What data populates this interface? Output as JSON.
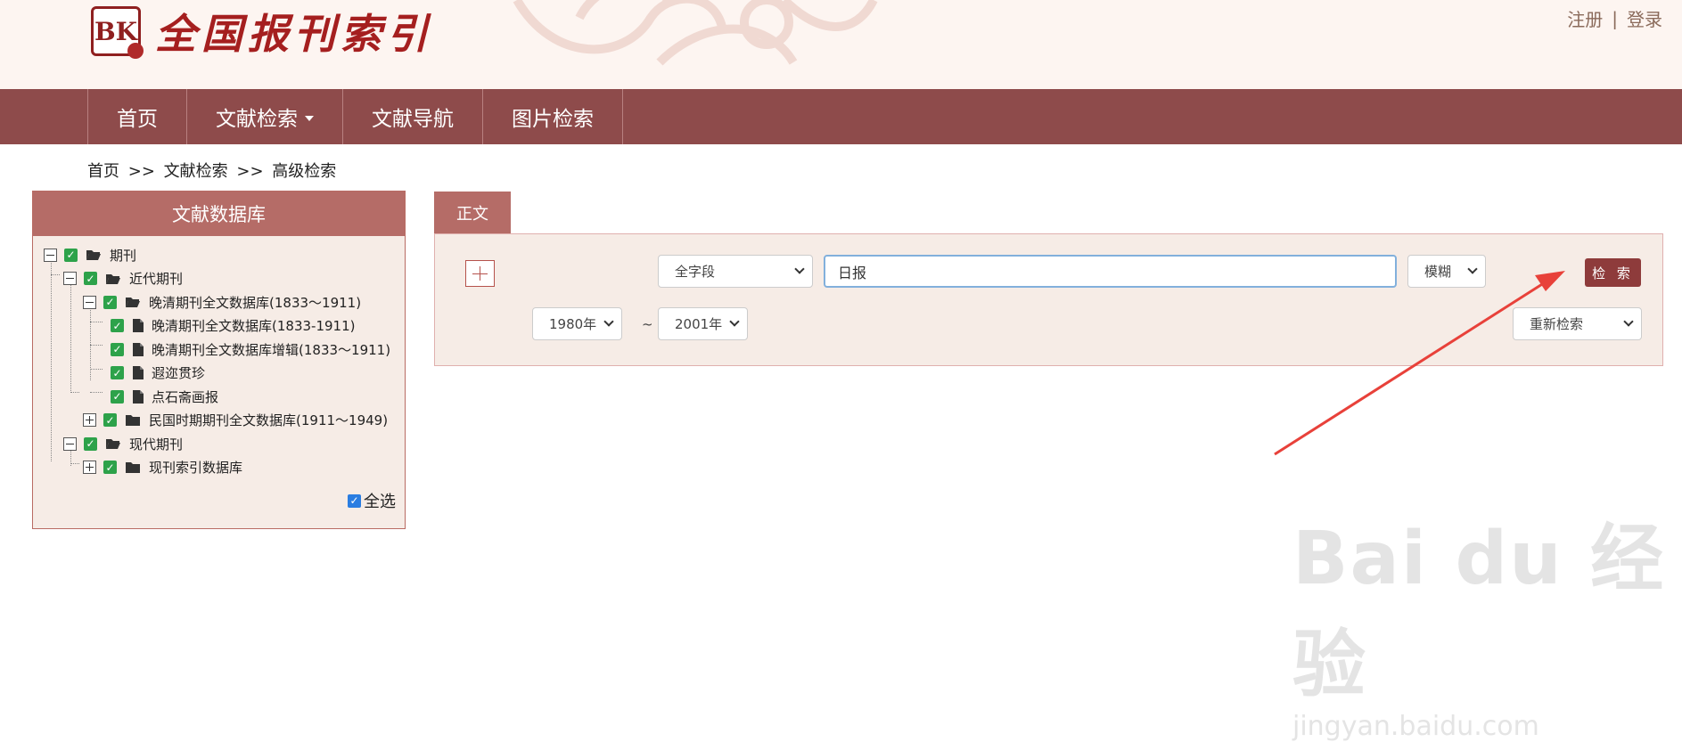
{
  "header": {
    "logo_mark": "BK",
    "logo_text": "全国报刊索引",
    "register": "注册",
    "separator": "|",
    "login": "登录"
  },
  "nav": {
    "items": [
      {
        "label": "首页"
      },
      {
        "label": "文献检索"
      },
      {
        "label": "文献导航"
      },
      {
        "label": "图片检索"
      }
    ]
  },
  "breadcrumb": {
    "home": "首页",
    "sep1": ">>",
    "level1": "文献检索",
    "sep2": ">>",
    "current": "高级检索"
  },
  "db_panel": {
    "title": "文献数据库",
    "tree": [
      {
        "label": "期刊"
      },
      {
        "label": "近代期刊"
      },
      {
        "label": "晚清期刊全文数据库(1833～1911)"
      },
      {
        "label": "晚清期刊全文数据库(1833-1911)"
      },
      {
        "label": "晚清期刊全文数据库增辑(1833～1911)"
      },
      {
        "label": "遐迩贯珍"
      },
      {
        "label": "点石斋画报"
      },
      {
        "label": "民国时期期刊全文数据库(1911～1949)"
      },
      {
        "label": "现代期刊"
      },
      {
        "label": "现刊索引数据库"
      }
    ],
    "select_all": "全选"
  },
  "search": {
    "tab": "正文",
    "field_select": "全字段",
    "query_value": "日报",
    "match_select": "模糊",
    "search_button": "检 索",
    "year_from": "1980年",
    "range_sep": "~",
    "year_to": "2001年",
    "research_select": "重新检索"
  },
  "watermark": {
    "brand": "Bai du 经验",
    "url": "jingyan.baidu.com"
  },
  "colors": {
    "nav_bg": "#8e4b4b",
    "panel_title": "#b56c67",
    "search_button": "#8e3b3b",
    "checkbox": "#2da24a",
    "annotation_arrow": "#e8413a"
  }
}
